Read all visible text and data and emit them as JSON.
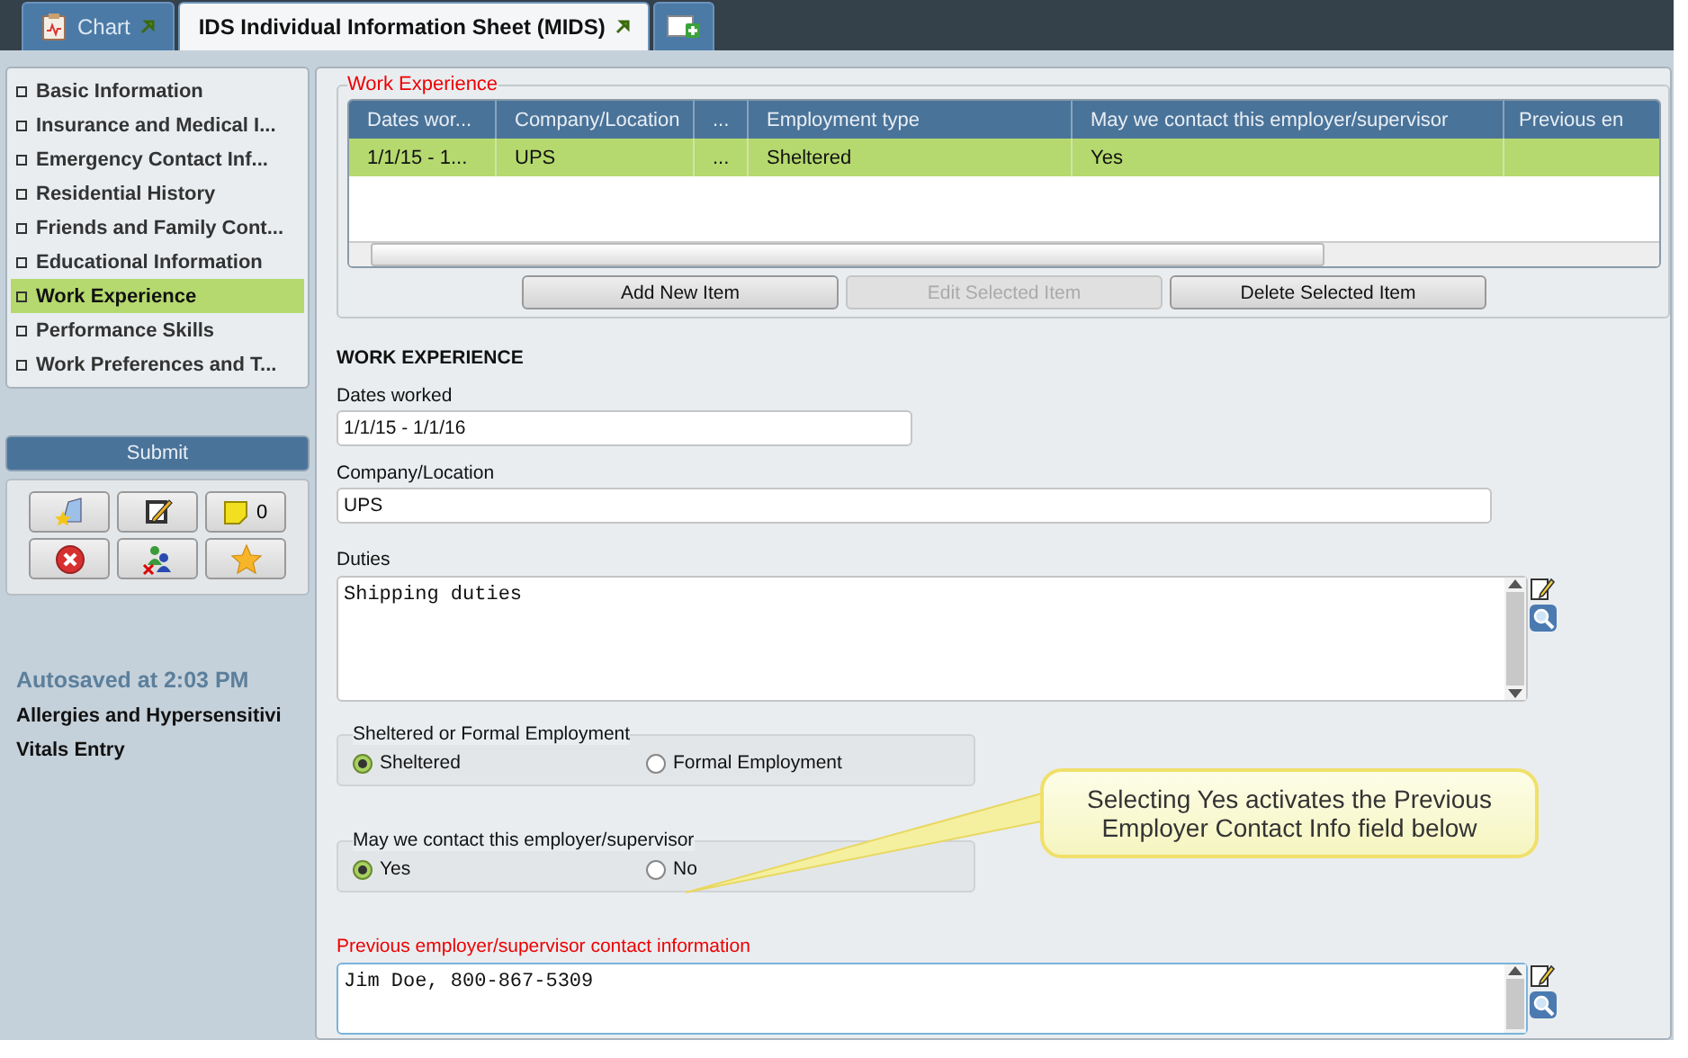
{
  "tabs": [
    {
      "label": "Chart",
      "selected": false
    },
    {
      "label": "IDS Individual Information Sheet (MIDS)",
      "selected": true
    }
  ],
  "sidebar": {
    "items": [
      {
        "label": "Basic Information",
        "selected": false
      },
      {
        "label": "Insurance and Medical I...",
        "selected": false
      },
      {
        "label": "Emergency Contact Inf...",
        "selected": false
      },
      {
        "label": "Residential History",
        "selected": false
      },
      {
        "label": "Friends and Family Cont...",
        "selected": false
      },
      {
        "label": "Educational Information",
        "selected": false
      },
      {
        "label": "Work Experience",
        "selected": true
      },
      {
        "label": "Performance Skills",
        "selected": false
      },
      {
        "label": "Work Preferences and T...",
        "selected": false
      }
    ],
    "submit": "Submit",
    "note_count": "0",
    "autosaved": "Autosaved at 2:03 PM",
    "links": [
      "Allergies and Hypersensitivi",
      "Vitals Entry"
    ]
  },
  "grid": {
    "legend": "Work Experience",
    "columns": [
      "Dates wor...",
      "Company/Location",
      "...",
      "Employment type",
      "May we contact this employer/supervisor",
      "Previous en"
    ],
    "rows": [
      {
        "cells": [
          "1/1/15 - 1...",
          "UPS",
          "...",
          "Sheltered",
          "Yes",
          ""
        ],
        "selected": true
      }
    ],
    "buttons": [
      {
        "label": "Add New Item",
        "disabled": false
      },
      {
        "label": "Edit Selected Item",
        "disabled": true
      },
      {
        "label": "Delete Selected Item",
        "disabled": false
      }
    ]
  },
  "form": {
    "heading": "WORK EXPERIENCE",
    "dates": {
      "label": "Dates worked",
      "value": "1/1/15 - 1/1/16"
    },
    "company": {
      "label": "Company/Location",
      "value": "UPS"
    },
    "duties": {
      "label": "Duties",
      "value": "Shipping duties"
    },
    "radio_groups": [
      {
        "legend": "Sheltered or Formal Employment",
        "options": [
          {
            "label": "Sheltered",
            "selected": true
          },
          {
            "label": "Formal Employment",
            "selected": false
          }
        ]
      },
      {
        "legend": "May we contact this employer/supervisor",
        "options": [
          {
            "label": "Yes",
            "selected": true
          },
          {
            "label": "No",
            "selected": false
          }
        ]
      }
    ],
    "previous_contact": {
      "label": "Previous employer/supervisor contact information",
      "value": "Jim Doe, 800-867-5309"
    }
  },
  "callout": "Selecting Yes activates the Previous Employer Contact Info field below"
}
